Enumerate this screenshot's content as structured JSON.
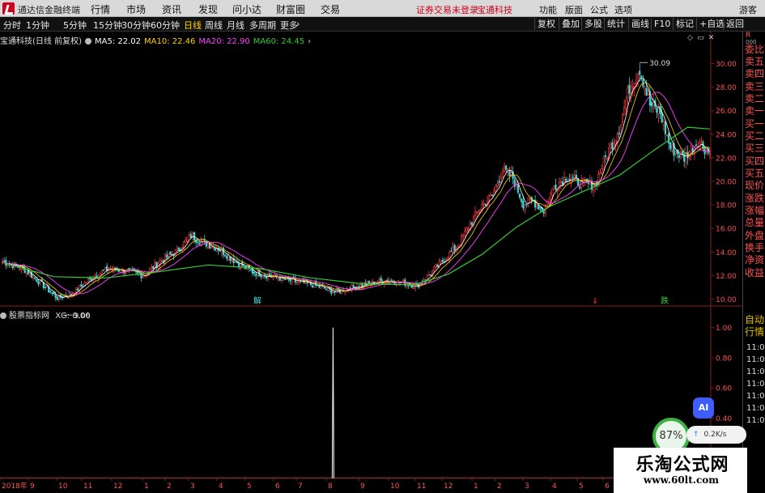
{
  "menubar": {
    "app_name": "通达信金融终端",
    "items": [
      "行情",
      "市场",
      "资讯",
      "发现",
      "问小达",
      "财富圈",
      "交易"
    ],
    "notice": "证券交易未登录",
    "stock_link": "宝通科技",
    "right_items": [
      "功能",
      "版面",
      "公式",
      "选项"
    ],
    "user": "游客"
  },
  "toolbar": {
    "periods": [
      "分时",
      "1分钟",
      "5分钟",
      "15分钟",
      "30分钟",
      "60分钟",
      "日线",
      "周线",
      "月线",
      "多周期",
      "更多"
    ],
    "active_period": "日线",
    "right_buttons": [
      "复权",
      "叠加",
      "多股",
      "统计",
      "画线",
      "F10",
      "标记",
      "+自选",
      "返回"
    ]
  },
  "info_line": {
    "title": "宝通科技(日线 前复权)",
    "ma": [
      {
        "label": "MA5: 22.02",
        "color": "#ffffff"
      },
      {
        "label": "MA10: 22.46",
        "color": "#ffd200"
      },
      {
        "label": "MA20: 22.90",
        "color": "#ff40ff"
      },
      {
        "label": "MA60: 24.45",
        "color": "#33cc33"
      }
    ]
  },
  "indicator_line": {
    "title": "股票指标网",
    "value": "XG: 0.00"
  },
  "side_panel": {
    "top_red": "R",
    "top_small": "000",
    "labels": [
      "委比",
      "卖五",
      "卖四",
      "卖三",
      "卖二",
      "卖一",
      "买一",
      "买二",
      "买三",
      "买四",
      "买五",
      "现价",
      "涨跌",
      "涨幅",
      "总量",
      "外盘",
      "换手",
      "净资",
      "收益"
    ],
    "lower_labels": [
      "自动",
      "行情"
    ],
    "times": [
      "11:01",
      "11:01",
      "11:02",
      "11:02",
      "11:02",
      "11:02",
      "11:02"
    ]
  },
  "overlays": {
    "ai_label": "AI",
    "widget_percent": "87%",
    "widget_speed": "0.2K/s",
    "watermark_line1": "乐淘公式网",
    "watermark_line2": "www.60lt.com"
  },
  "chart_data": [
    {
      "type": "candlestick",
      "title": "宝通科技(日线 前复权)",
      "ylim": [
        9,
        31
      ],
      "y_ticks": [
        "10.00",
        "12.00",
        "14.00",
        "16.00",
        "18.00",
        "20.00",
        "22.00",
        "24.00",
        "26.00",
        "28.00",
        "30.00"
      ],
      "x_tick_labels": [
        "2018年",
        "9",
        "10",
        "11",
        "12",
        "1",
        "2",
        "3",
        "4",
        "5",
        "6",
        "7",
        "8",
        "9",
        "10",
        "11",
        "12",
        "1",
        "2",
        "3",
        "4",
        "5",
        "6",
        "7",
        "8"
      ],
      "annotations": [
        {
          "text": "9.06",
          "kind": "low"
        },
        {
          "text": "30.09",
          "kind": "high"
        }
      ],
      "event_markers": [
        {
          "text": "解",
          "color": "#44dddd"
        },
        {
          "text": "⇓",
          "color": "#ff3030"
        },
        {
          "text": "跌",
          "color": "#33cc33"
        }
      ],
      "anchors": [
        [
          0,
          13.2
        ],
        [
          12,
          12.6
        ],
        [
          22,
          11.4
        ],
        [
          32,
          10.1
        ],
        [
          40,
          10.4
        ],
        [
          52,
          11.8
        ],
        [
          62,
          12.6
        ],
        [
          72,
          12.4
        ],
        [
          82,
          12.0
        ],
        [
          92,
          13.2
        ],
        [
          102,
          14.1
        ],
        [
          110,
          15.4
        ],
        [
          116,
          14.9
        ],
        [
          126,
          14.3
        ],
        [
          136,
          13.2
        ],
        [
          146,
          12.3
        ],
        [
          158,
          11.9
        ],
        [
          170,
          11.5
        ],
        [
          182,
          11.2
        ],
        [
          194,
          10.6
        ],
        [
          204,
          11.0
        ],
        [
          214,
          11.3
        ],
        [
          224,
          11.6
        ],
        [
          234,
          11.4
        ],
        [
          242,
          11.1
        ],
        [
          250,
          12.2
        ],
        [
          258,
          13.4
        ],
        [
          266,
          14.6
        ],
        [
          274,
          16.6
        ],
        [
          280,
          18.0
        ],
        [
          286,
          18.8
        ],
        [
          292,
          21.0
        ],
        [
          298,
          20.3
        ],
        [
          304,
          18.1
        ],
        [
          310,
          18.3
        ],
        [
          316,
          17.5
        ],
        [
          322,
          19.6
        ],
        [
          330,
          20.4
        ],
        [
          338,
          19.8
        ],
        [
          346,
          19.7
        ],
        [
          352,
          22.0
        ],
        [
          360,
          24.5
        ],
        [
          366,
          28.0
        ],
        [
          372,
          29.6
        ],
        [
          378,
          26.5
        ],
        [
          384,
          25.8
        ],
        [
          390,
          22.8
        ],
        [
          398,
          22.0
        ],
        [
          406,
          23.5
        ],
        [
          413,
          22.3
        ]
      ],
      "ma60_points": [
        [
          0,
          13.1
        ],
        [
          30,
          11.9
        ],
        [
          60,
          11.8
        ],
        [
          90,
          12.3
        ],
        [
          120,
          12.9
        ],
        [
          150,
          12.6
        ],
        [
          180,
          11.8
        ],
        [
          210,
          11.3
        ],
        [
          240,
          11.2
        ],
        [
          260,
          12.1
        ],
        [
          280,
          13.8
        ],
        [
          300,
          16.1
        ],
        [
          320,
          17.9
        ],
        [
          340,
          19.2
        ],
        [
          360,
          20.5
        ],
        [
          380,
          22.6
        ],
        [
          400,
          24.6
        ],
        [
          413,
          24.45
        ]
      ],
      "series": [
        {
          "name": "MA5",
          "value": 22.02,
          "color": "#ffffff"
        },
        {
          "name": "MA10",
          "value": 22.46,
          "color": "#ffd200"
        },
        {
          "name": "MA20",
          "value": 22.9,
          "color": "#ff40ff"
        },
        {
          "name": "MA60",
          "value": 24.45,
          "color": "#33cc33"
        }
      ]
    },
    {
      "type": "line",
      "title": "股票指标网",
      "series": [
        {
          "name": "XG",
          "values": [
            0,
            1,
            0
          ],
          "spike_at_candle": 193
        }
      ],
      "ylim": [
        0,
        1.1
      ],
      "y_ticks": [
        "0.40",
        "0.60",
        "0.80",
        "1.00"
      ]
    }
  ]
}
